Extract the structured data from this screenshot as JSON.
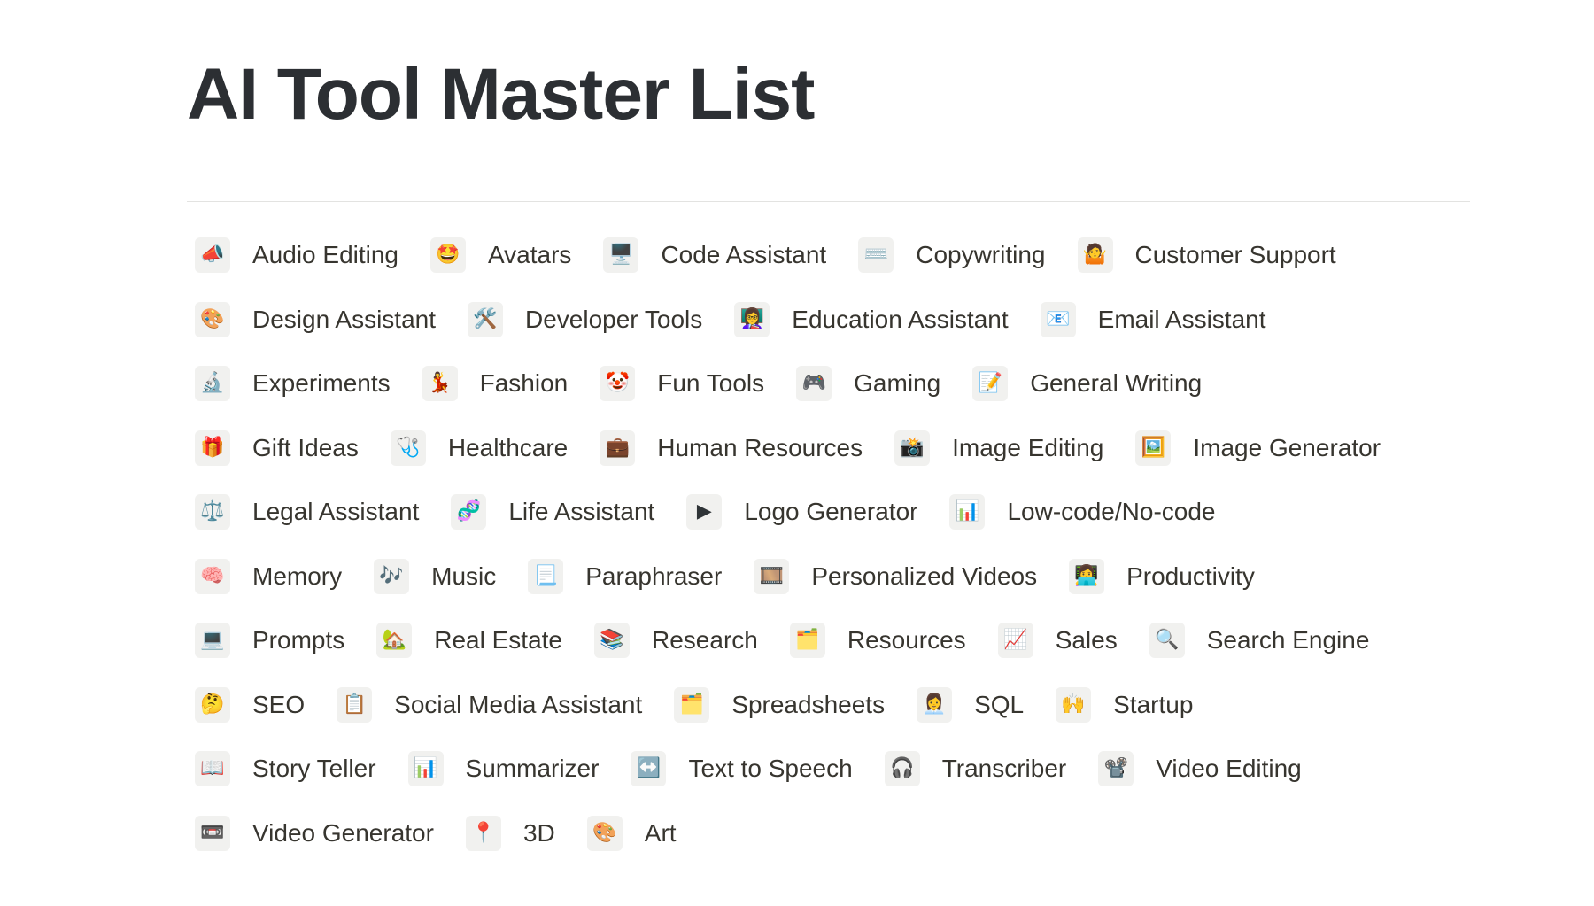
{
  "page": {
    "title": "AI Tool Master List"
  },
  "tags": {
    "rows": [
      [
        {
          "label": "Audio Editing",
          "icon": "📣",
          "icon_name": "megaphone-icon"
        },
        {
          "label": "Avatars",
          "icon": "🤩",
          "icon_name": "star-struck-face-icon"
        },
        {
          "label": "Code Assistant",
          "icon": "🖥️",
          "icon_name": "desktop-computer-icon"
        },
        {
          "label": "Copywriting",
          "icon": "⌨️",
          "icon_name": "keyboard-icon"
        },
        {
          "label": "Customer Support",
          "icon": "🤷",
          "icon_name": "person-icon"
        }
      ],
      [
        {
          "label": "Design Assistant",
          "icon": "🎨",
          "icon_name": "palette-icon"
        },
        {
          "label": "Developer Tools",
          "icon": "🛠️",
          "icon_name": "tools-icon"
        },
        {
          "label": "Education Assistant",
          "icon": "👩‍🏫",
          "icon_name": "teacher-icon"
        },
        {
          "label": "Email Assistant",
          "icon": "📧",
          "icon_name": "email-icon"
        }
      ],
      [
        {
          "label": "Experiments",
          "icon": "🔬",
          "icon_name": "microscope-icon"
        },
        {
          "label": "Fashion",
          "icon": "💃",
          "icon_name": "dancer-icon"
        },
        {
          "label": "Fun Tools",
          "icon": "🤡",
          "icon_name": "clown-face-icon"
        },
        {
          "label": "Gaming",
          "icon": "🎮",
          "icon_name": "game-controller-icon"
        },
        {
          "label": "General Writing",
          "icon": "📝",
          "icon_name": "memo-icon"
        }
      ],
      [
        {
          "label": "Gift Ideas",
          "icon": "🎁",
          "icon_name": "gift-icon"
        },
        {
          "label": "Healthcare",
          "icon": "🩺",
          "icon_name": "stethoscope-icon"
        },
        {
          "label": "Human Resources",
          "icon": "💼",
          "icon_name": "briefcase-icon"
        },
        {
          "label": "Image Editing",
          "icon": "📸",
          "icon_name": "camera-flash-icon"
        },
        {
          "label": "Image Generator",
          "icon": "🖼️",
          "icon_name": "framed-picture-icon"
        }
      ],
      [
        {
          "label": "Legal Assistant",
          "icon": "⚖️",
          "icon_name": "balance-scale-icon"
        },
        {
          "label": "Life Assistant",
          "icon": "🧬",
          "icon_name": "dna-icon"
        },
        {
          "label": "Logo Generator",
          "icon": "▶",
          "icon_name": "play-icon"
        },
        {
          "label": "Low-code/No-code",
          "icon": "📊",
          "icon_name": "bar-chart-icon"
        }
      ],
      [
        {
          "label": "Memory",
          "icon": "🧠",
          "icon_name": "brain-icon"
        },
        {
          "label": "Music",
          "icon": "🎶",
          "icon_name": "musical-notes-icon"
        },
        {
          "label": "Paraphraser",
          "icon": "📃",
          "icon_name": "page-icon"
        },
        {
          "label": "Personalized Videos",
          "icon": "🎞️",
          "icon_name": "film-frames-icon"
        },
        {
          "label": "Productivity",
          "icon": "👩‍💻",
          "icon_name": "technologist-icon"
        }
      ],
      [
        {
          "label": "Prompts",
          "icon": "💻",
          "icon_name": "laptop-icon"
        },
        {
          "label": "Real Estate",
          "icon": "🏡",
          "icon_name": "house-garden-icon"
        },
        {
          "label": "Research",
          "icon": "📚",
          "icon_name": "books-icon"
        },
        {
          "label": "Resources",
          "icon": "🗂️",
          "icon_name": "card-index-dividers-icon"
        },
        {
          "label": "Sales",
          "icon": "📈",
          "icon_name": "chart-increasing-icon"
        },
        {
          "label": "Search Engine",
          "icon": "🔍",
          "icon_name": "magnifying-glass-icon"
        }
      ],
      [
        {
          "label": "SEO",
          "icon": "🤔",
          "icon_name": "thinking-face-icon"
        },
        {
          "label": "Social Media Assistant",
          "icon": "📋",
          "icon_name": "clipboard-icon"
        },
        {
          "label": "Spreadsheets",
          "icon": "🗂️",
          "icon_name": "folder-icon"
        },
        {
          "label": "SQL",
          "icon": "👩‍💼",
          "icon_name": "office-worker-icon"
        },
        {
          "label": "Startup",
          "icon": "🙌",
          "icon_name": "raised-hands-icon"
        }
      ],
      [
        {
          "label": "Story Teller",
          "icon": "📖",
          "icon_name": "open-book-icon"
        },
        {
          "label": "Summarizer",
          "icon": "📊",
          "icon_name": "bar-chart-icon"
        },
        {
          "label": "Text to Speech",
          "icon": "↔️",
          "icon_name": "left-right-arrow-icon"
        },
        {
          "label": "Transcriber",
          "icon": "🎧",
          "icon_name": "headphones-icon"
        },
        {
          "label": "Video Editing",
          "icon": "📽️",
          "icon_name": "film-projector-icon"
        }
      ],
      [
        {
          "label": "Video Generator",
          "icon": "📼",
          "icon_name": "videocassette-icon"
        },
        {
          "label": "3D",
          "icon": "📍",
          "icon_name": "round-pushpin-icon"
        },
        {
          "label": "Art",
          "icon": "🎨",
          "icon_name": "palette-icon"
        }
      ]
    ]
  }
}
